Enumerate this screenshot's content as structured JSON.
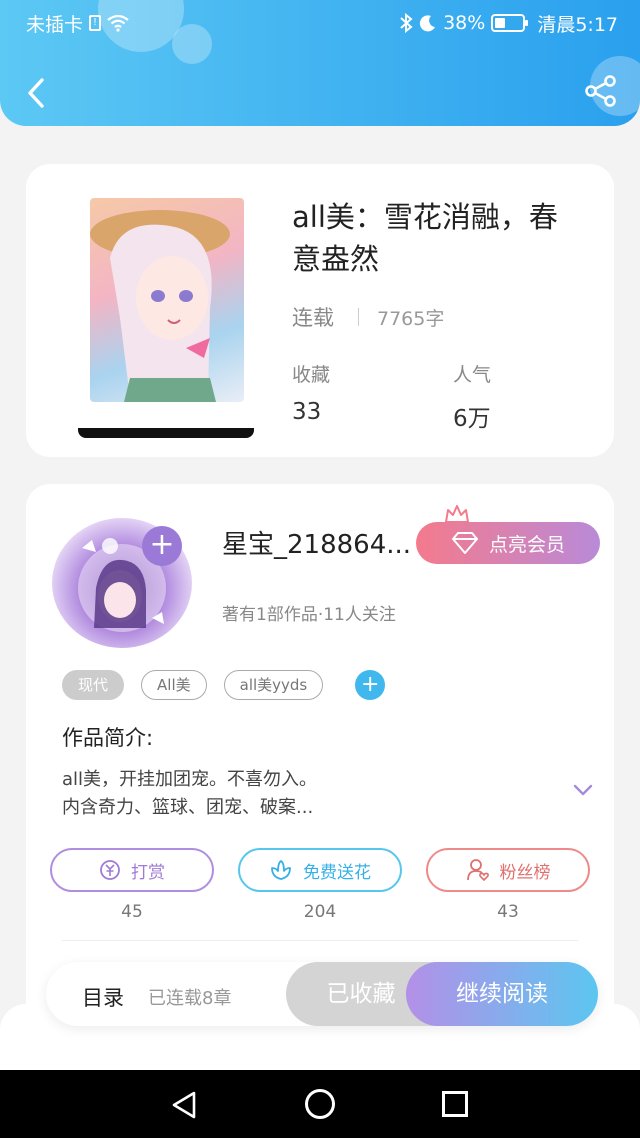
{
  "status_bar": {
    "carrier": "未插卡",
    "battery": "38%",
    "time": "清晨5:17",
    "battery_level": 0.38
  },
  "header": {
    "back_icon": "chevron-left-icon",
    "share_icon": "share-icon",
    "color_start": "#5cc8f4",
    "color_end": "#2aa0ee"
  },
  "book": {
    "title": "all美：雪花消融，春意盎然",
    "status": "连载",
    "word_count": "7765字",
    "collect_label": "收藏",
    "collect_value": "33",
    "popularity_label": "人气",
    "popularity_value": "6万"
  },
  "author": {
    "name": "星宝_218864...",
    "vip_label": "点亮会员",
    "info": "著有1部作品·11人关注",
    "tags": [
      "现代",
      "All美",
      "all美yyds"
    ],
    "intro_heading": "作品简介:",
    "intro_line1": "all美，开挂加团宠。不喜勿入。",
    "intro_line2": "内含奇力、篮球、团宠、破案..."
  },
  "actions": {
    "reward_label": "打赏",
    "reward_count": "45",
    "flower_label": "免费送花",
    "flower_count": "204",
    "fans_label": "粉丝榜",
    "fans_count": "43"
  },
  "bottom_bar": {
    "toc_label": "目录",
    "serial_label": "已连载8章",
    "collected_label": "已收藏",
    "continue_label": "继续阅读"
  }
}
